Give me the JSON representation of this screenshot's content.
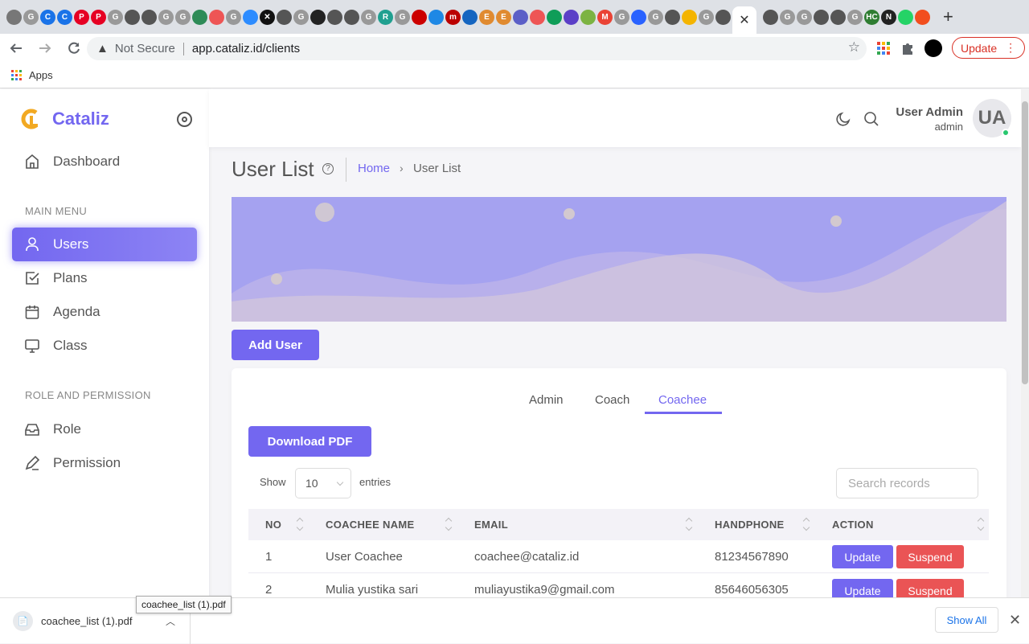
{
  "browser": {
    "tabs_strip": {
      "favicons": [
        {
          "glyph": "",
          "color": "#777"
        },
        {
          "glyph": "G",
          "color": "#999"
        },
        {
          "glyph": "C",
          "color": "#1a73e8"
        },
        {
          "glyph": "C",
          "color": "#1a73e8"
        },
        {
          "glyph": "P",
          "color": "#e60023"
        },
        {
          "glyph": "P",
          "color": "#e60023"
        },
        {
          "glyph": "G",
          "color": "#999"
        },
        {
          "glyph": "",
          "color": "#555"
        },
        {
          "glyph": "",
          "color": "#555"
        },
        {
          "glyph": "G",
          "color": "#999"
        },
        {
          "glyph": "G",
          "color": "#999"
        },
        {
          "glyph": "",
          "color": "#2e8b57"
        },
        {
          "glyph": "",
          "color": "#e55"
        },
        {
          "glyph": "G",
          "color": "#999"
        },
        {
          "glyph": "",
          "color": "#2d8cff"
        },
        {
          "glyph": "✕",
          "color": "#111"
        },
        {
          "glyph": "",
          "color": "#555"
        },
        {
          "glyph": "G",
          "color": "#999"
        },
        {
          "glyph": "",
          "color": "#222"
        },
        {
          "glyph": "",
          "color": "#555"
        },
        {
          "glyph": "",
          "color": "#555"
        },
        {
          "glyph": "G",
          "color": "#999"
        },
        {
          "glyph": "R",
          "color": "#20a090"
        },
        {
          "glyph": "G",
          "color": "#999"
        },
        {
          "glyph": "",
          "color": "#c00"
        },
        {
          "glyph": "",
          "color": "#1e88e5"
        },
        {
          "glyph": "m",
          "color": "#b00"
        },
        {
          "glyph": "",
          "color": "#1565c0"
        },
        {
          "glyph": "E",
          "color": "#e08a30"
        },
        {
          "glyph": "E",
          "color": "#e08a30"
        },
        {
          "glyph": "",
          "color": "#5b5fc7"
        },
        {
          "glyph": "",
          "color": "#e55"
        },
        {
          "glyph": "",
          "color": "#0f9d58"
        },
        {
          "glyph": "",
          "color": "#5b3fc7"
        },
        {
          "glyph": "",
          "color": "#7cb342"
        },
        {
          "glyph": "M",
          "color": "#ea4335"
        },
        {
          "glyph": "G",
          "color": "#999"
        },
        {
          "glyph": "",
          "color": "#2962ff"
        },
        {
          "glyph": "G",
          "color": "#999"
        },
        {
          "glyph": "",
          "color": "#555"
        },
        {
          "glyph": "",
          "color": "#f4b400"
        },
        {
          "glyph": "G",
          "color": "#999"
        },
        {
          "glyph": "",
          "color": "#555"
        }
      ],
      "favicons_after": [
        {
          "glyph": "",
          "color": "#555"
        },
        {
          "glyph": "G",
          "color": "#999"
        },
        {
          "glyph": "G",
          "color": "#999"
        },
        {
          "glyph": "",
          "color": "#555"
        },
        {
          "glyph": "",
          "color": "#555"
        },
        {
          "glyph": "G",
          "color": "#999"
        },
        {
          "glyph": "HC",
          "color": "#2e7d32"
        },
        {
          "glyph": "N",
          "color": "#222"
        },
        {
          "glyph": "",
          "color": "#25d366"
        },
        {
          "glyph": "",
          "color": "#f24e1e"
        }
      ],
      "active_tab_close": "✕",
      "new_tab": "+"
    },
    "address": {
      "security_label": "Not Secure",
      "url": "app.cataliz.id/clients"
    },
    "update_label": "Update",
    "bookmarks": {
      "apps_label": "Apps"
    }
  },
  "sidebar": {
    "brand": "Cataliz",
    "dashboard_label": "Dashboard",
    "main_menu_heading": "MAIN MENU",
    "main_items": [
      {
        "label": "Users",
        "icon": "user-icon"
      },
      {
        "label": "Plans",
        "icon": "check-square-icon"
      },
      {
        "label": "Agenda",
        "icon": "calendar-icon"
      },
      {
        "label": "Class",
        "icon": "monitor-icon"
      }
    ],
    "role_heading": "ROLE AND PERMISSION",
    "role_items": [
      {
        "label": "Role",
        "icon": "inbox-icon"
      },
      {
        "label": "Permission",
        "icon": "edit-icon"
      }
    ]
  },
  "header": {
    "user_name": "User Admin",
    "user_role": "admin",
    "avatar_initials": "UA"
  },
  "page": {
    "title": "User List",
    "breadcrumb_home": "Home",
    "breadcrumb_current": "User List",
    "add_user_label": "Add User"
  },
  "card": {
    "tabs": [
      "Admin",
      "Coach",
      "Coachee"
    ],
    "active_tab": "Coachee",
    "download_label": "Download PDF",
    "show_label": "Show",
    "entries_value": "10",
    "entries_label": "entries",
    "search_placeholder": "Search records",
    "columns": [
      "NO",
      "COACHEE NAME",
      "EMAIL",
      "HANDPHONE",
      "ACTION"
    ],
    "rows": [
      {
        "no": "1",
        "name": "User Coachee",
        "email": "coachee@cataliz.id",
        "phone": "81234567890"
      },
      {
        "no": "2",
        "name": "Mulia yustika sari",
        "email": "muliayustika9@gmail.com",
        "phone": "85646056305"
      }
    ],
    "update_label": "Update",
    "suspend_label": "Suspend"
  },
  "downloads": {
    "file_name": "coachee_list (1).pdf",
    "tooltip": "coachee_list (1).pdf",
    "show_all_label": "Show All"
  },
  "colors": {
    "accent": "#7367f0",
    "danger": "#ea5455",
    "online": "#28c76f"
  }
}
